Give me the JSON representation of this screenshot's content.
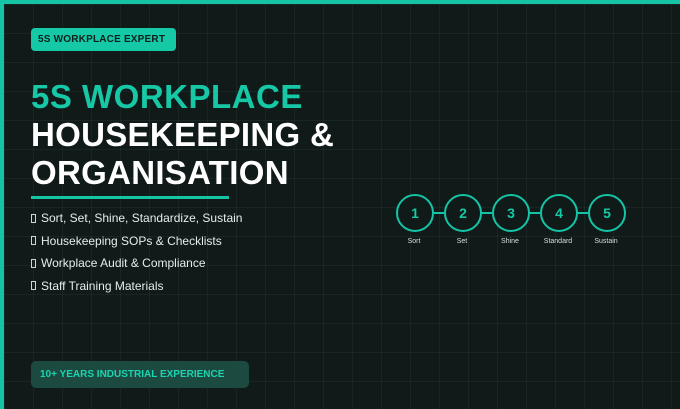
{
  "badge": "5S WORKPLACE EXPERT",
  "title": {
    "accent": "5S WORKPLACE",
    "line2": "HOUSEKEEPING &",
    "line3": "ORGANISATION"
  },
  "bullets": [
    "Sort, Set, Shine, Standardize, Sustain",
    "Housekeeping SOPs & Checklists",
    "Workplace Audit & Compliance",
    "Staff Training Materials"
  ],
  "steps": [
    {
      "number": "1",
      "label": "Sort"
    },
    {
      "number": "2",
      "label": "Set"
    },
    {
      "number": "3",
      "label": "Shine"
    },
    {
      "number": "4",
      "label": "Standard"
    },
    {
      "number": "5",
      "label": "Sustain"
    }
  ],
  "experience": "10+ YEARS INDUSTRIAL EXPERIENCE",
  "colors": {
    "accent": "#14c4a4",
    "background": "#101a19",
    "experience_bg": "#1d4a40"
  }
}
